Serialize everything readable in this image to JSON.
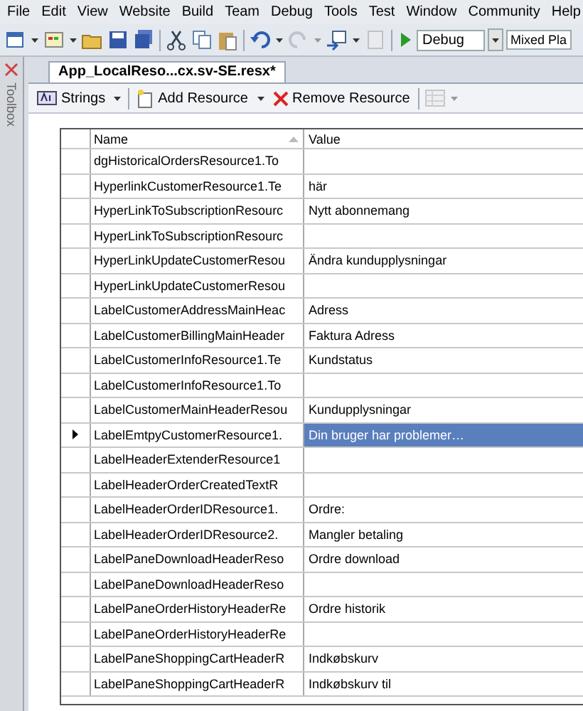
{
  "menu": [
    "File",
    "Edit",
    "View",
    "Website",
    "Build",
    "Team",
    "Debug",
    "Tools",
    "Test",
    "Window",
    "Community",
    "Help"
  ],
  "toolbar": {
    "config": "Debug",
    "platform": "Mixed Pla"
  },
  "sidebar": {
    "label": "Toolbox"
  },
  "tab": {
    "title": "App_LocalReso...cx.sv-SE.resx*",
    "selected": true
  },
  "resource_toolbar": {
    "strings": "Strings",
    "add": "Add Resource",
    "remove": "Remove Resource"
  },
  "table": {
    "columns": [
      "Name",
      "Value"
    ],
    "rows": [
      {
        "name": "dgHistoricalOrdersResource1.To",
        "value": "",
        "selected": false
      },
      {
        "name": "HyperlinkCustomerResource1.Te",
        "value": "här",
        "selected": false
      },
      {
        "name": "HyperLinkToSubscriptionResourc",
        "value": "Nytt abonnemang",
        "selected": false
      },
      {
        "name": "HyperLinkToSubscriptionResourc",
        "value": "",
        "selected": false
      },
      {
        "name": "HyperLinkUpdateCustomerResou",
        "value": "Ändra kundupplysningar",
        "selected": false
      },
      {
        "name": "HyperLinkUpdateCustomerResou",
        "value": "",
        "selected": false
      },
      {
        "name": "LabelCustomerAddressMainHeac",
        "value": "Adress",
        "selected": false
      },
      {
        "name": "LabelCustomerBillingMainHeader",
        "value": "Faktura Adress",
        "selected": false
      },
      {
        "name": "LabelCustomerInfoResource1.Te",
        "value": "Kundstatus",
        "selected": false
      },
      {
        "name": "LabelCustomerInfoResource1.To",
        "value": "",
        "selected": false
      },
      {
        "name": "LabelCustomerMainHeaderResou",
        "value": "Kundupplysningar",
        "selected": false
      },
      {
        "name": "LabelEmtpyCustomerResource1.",
        "value": "Din bruger har problemer…",
        "selected": true
      },
      {
        "name": "LabelHeaderExtenderResource1",
        "value": "",
        "selected": false
      },
      {
        "name": "LabelHeaderOrderCreatedTextR",
        "value": "",
        "selected": false
      },
      {
        "name": "LabelHeaderOrderIDResource1.",
        "value": "Ordre:",
        "selected": false
      },
      {
        "name": "LabelHeaderOrderIDResource2.",
        "value": "Mangler betaling",
        "selected": false
      },
      {
        "name": "LabelPaneDownloadHeaderReso",
        "value": "Ordre download",
        "selected": false
      },
      {
        "name": "LabelPaneDownloadHeaderReso",
        "value": "",
        "selected": false
      },
      {
        "name": "LabelPaneOrderHistoryHeaderRe",
        "value": "Ordre historik",
        "selected": false
      },
      {
        "name": "LabelPaneOrderHistoryHeaderRe",
        "value": "",
        "selected": false
      },
      {
        "name": "LabelPaneShoppingCartHeaderR",
        "value": "Indkøbskurv",
        "selected": false
      },
      {
        "name": "LabelPaneShoppingCartHeaderR",
        "value": "Indkøbskurv til",
        "selected": false
      }
    ]
  }
}
